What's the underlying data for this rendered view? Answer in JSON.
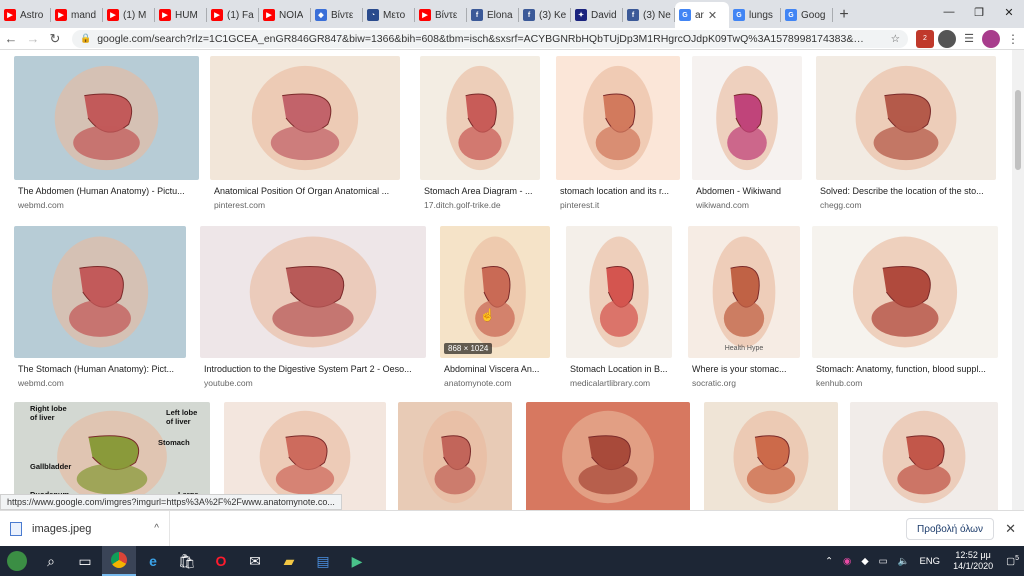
{
  "tabs": [
    {
      "label": "Astro",
      "color": "#ff0000",
      "glyph": "▶"
    },
    {
      "label": "mand",
      "color": "#ff0000",
      "glyph": "▶"
    },
    {
      "label": "(1) M",
      "color": "#ff0000",
      "glyph": "▶"
    },
    {
      "label": "HUM",
      "color": "#ff0000",
      "glyph": "▶"
    },
    {
      "label": "(1) Fa",
      "color": "#ff0000",
      "glyph": "▶"
    },
    {
      "label": "NOIA",
      "color": "#ff0000",
      "glyph": "▶"
    },
    {
      "label": "Βίντε",
      "color": "#3a6fd8",
      "glyph": "◆"
    },
    {
      "label": "Μετο",
      "color": "#2a4b8d",
      "glyph": "◔"
    },
    {
      "label": "Βίντε",
      "color": "#ff0000",
      "glyph": "▶"
    },
    {
      "label": "Elona",
      "color": "#3b5998",
      "glyph": "f"
    },
    {
      "label": "(3) Ke",
      "color": "#3b5998",
      "glyph": "f"
    },
    {
      "label": "David",
      "color": "#1a237e",
      "glyph": "✦"
    },
    {
      "label": "(3) Ne",
      "color": "#3b5998",
      "glyph": "f"
    },
    {
      "label": "ar",
      "color": "#4285f4",
      "glyph": "G",
      "active": true
    },
    {
      "label": "lungs",
      "color": "#4285f4",
      "glyph": "G"
    },
    {
      "label": "Goog",
      "color": "#4285f4",
      "glyph": "G"
    }
  ],
  "window": {
    "minimize": "—",
    "maximize": "❐",
    "close": "✕"
  },
  "toolbar": {
    "url": "google.com/search?rlz=1C1GCEA_enGR846GR847&biw=1366&bih=608&tbm=isch&sxsrf=ACYBGNRbHQbTUjDp3M1RHgrcOJdpK09TwQ%3A1578998174383&s...",
    "back": "←",
    "forward": "→",
    "reload": "↻",
    "star": "☆"
  },
  "extensions": {
    "badge_count": "2"
  },
  "results": [
    {
      "caption": "The Abdomen (Human Anatomy) - Pictu...",
      "source": "webmd.com",
      "bg": "#b7ccd6",
      "fg": "#c25a5a"
    },
    {
      "caption": "Anatomical Position Of Organ Anatomical ...",
      "source": "pinterest.com",
      "bg": "#f2e6d9",
      "fg": "#c2636a"
    },
    {
      "caption": "Stomach Area Diagram - ...",
      "source": "17.ditch.golf-trike.de",
      "bg": "#f3ede3",
      "fg": "#c85c58"
    },
    {
      "caption": "stomach location and its r...",
      "source": "pinterest.it",
      "bg": "#fbe6d8",
      "fg": "#d27a5d"
    },
    {
      "caption": "Abdomen - Wikiwand",
      "source": "wikiwand.com",
      "bg": "#f6f2f0",
      "fg": "#c0447a"
    },
    {
      "caption": "Solved: Describe the location of the sto...",
      "source": "chegg.com",
      "bg": "#f2ebe3",
      "fg": "#b45a4a"
    },
    {
      "caption": "The Stomach (Human Anatomy): Pict...",
      "source": "webmd.com",
      "bg": "#b7ccd6",
      "fg": "#c25a5a"
    },
    {
      "caption": "Introduction to the Digestive System Part 2 - Oeso...",
      "source": "youtube.com",
      "bg": "#eee6e8",
      "fg": "#b85a58"
    },
    {
      "caption": "Abdominal Viscera An...",
      "source": "anatomynote.com",
      "bg": "#f5e3c8",
      "fg": "#c96a55",
      "badge": "868 × 1024"
    },
    {
      "caption": "Stomach Location in B...",
      "source": "medicalartlibrary.com",
      "bg": "#f4efe9",
      "fg": "#d4554f"
    },
    {
      "caption": "Where is your stomac...",
      "source": "socratic.org",
      "bg": "#f6ece4",
      "fg": "#c06245",
      "note": "Health Hype"
    },
    {
      "caption": "Stomach: Anatomy, function, blood suppl...",
      "source": "kenhub.com",
      "bg": "#f6f3ee",
      "fg": "#b04a3d"
    },
    {
      "caption": "",
      "source": "",
      "bg": "#d3d8d2",
      "fg": "#8a9a3a",
      "labels": [
        "Right lobe of liver",
        "Left lobe of liver",
        "Stomach",
        "Gallbladder",
        "Duodenum",
        "Large"
      ]
    },
    {
      "caption": "",
      "source": "",
      "bg": "#f3e6de",
      "fg": "#cd6b5d"
    },
    {
      "caption": "",
      "source": "",
      "bg": "#e8cbb6",
      "fg": "#c2655a"
    },
    {
      "caption": "",
      "source": "",
      "bg": "#d77860",
      "fg": "#a84a3a"
    },
    {
      "caption": "",
      "source": "",
      "bg": "#efe4d6",
      "fg": "#cc6a4a"
    },
    {
      "caption": "",
      "source": "",
      "bg": "#f1ece9",
      "fg": "#c2574a"
    }
  ],
  "status_url": "https://www.google.com/imgres?imgurl=https%3A%2F%2Fwww.anatomynote.co...",
  "download": {
    "filename": "images.jpeg",
    "show_all": "Προβολή όλων",
    "chevron": "^"
  },
  "taskbar": {
    "lang": "ENG",
    "time": "12:52 μμ",
    "date": "14/1/2020",
    "notifications": "5"
  }
}
